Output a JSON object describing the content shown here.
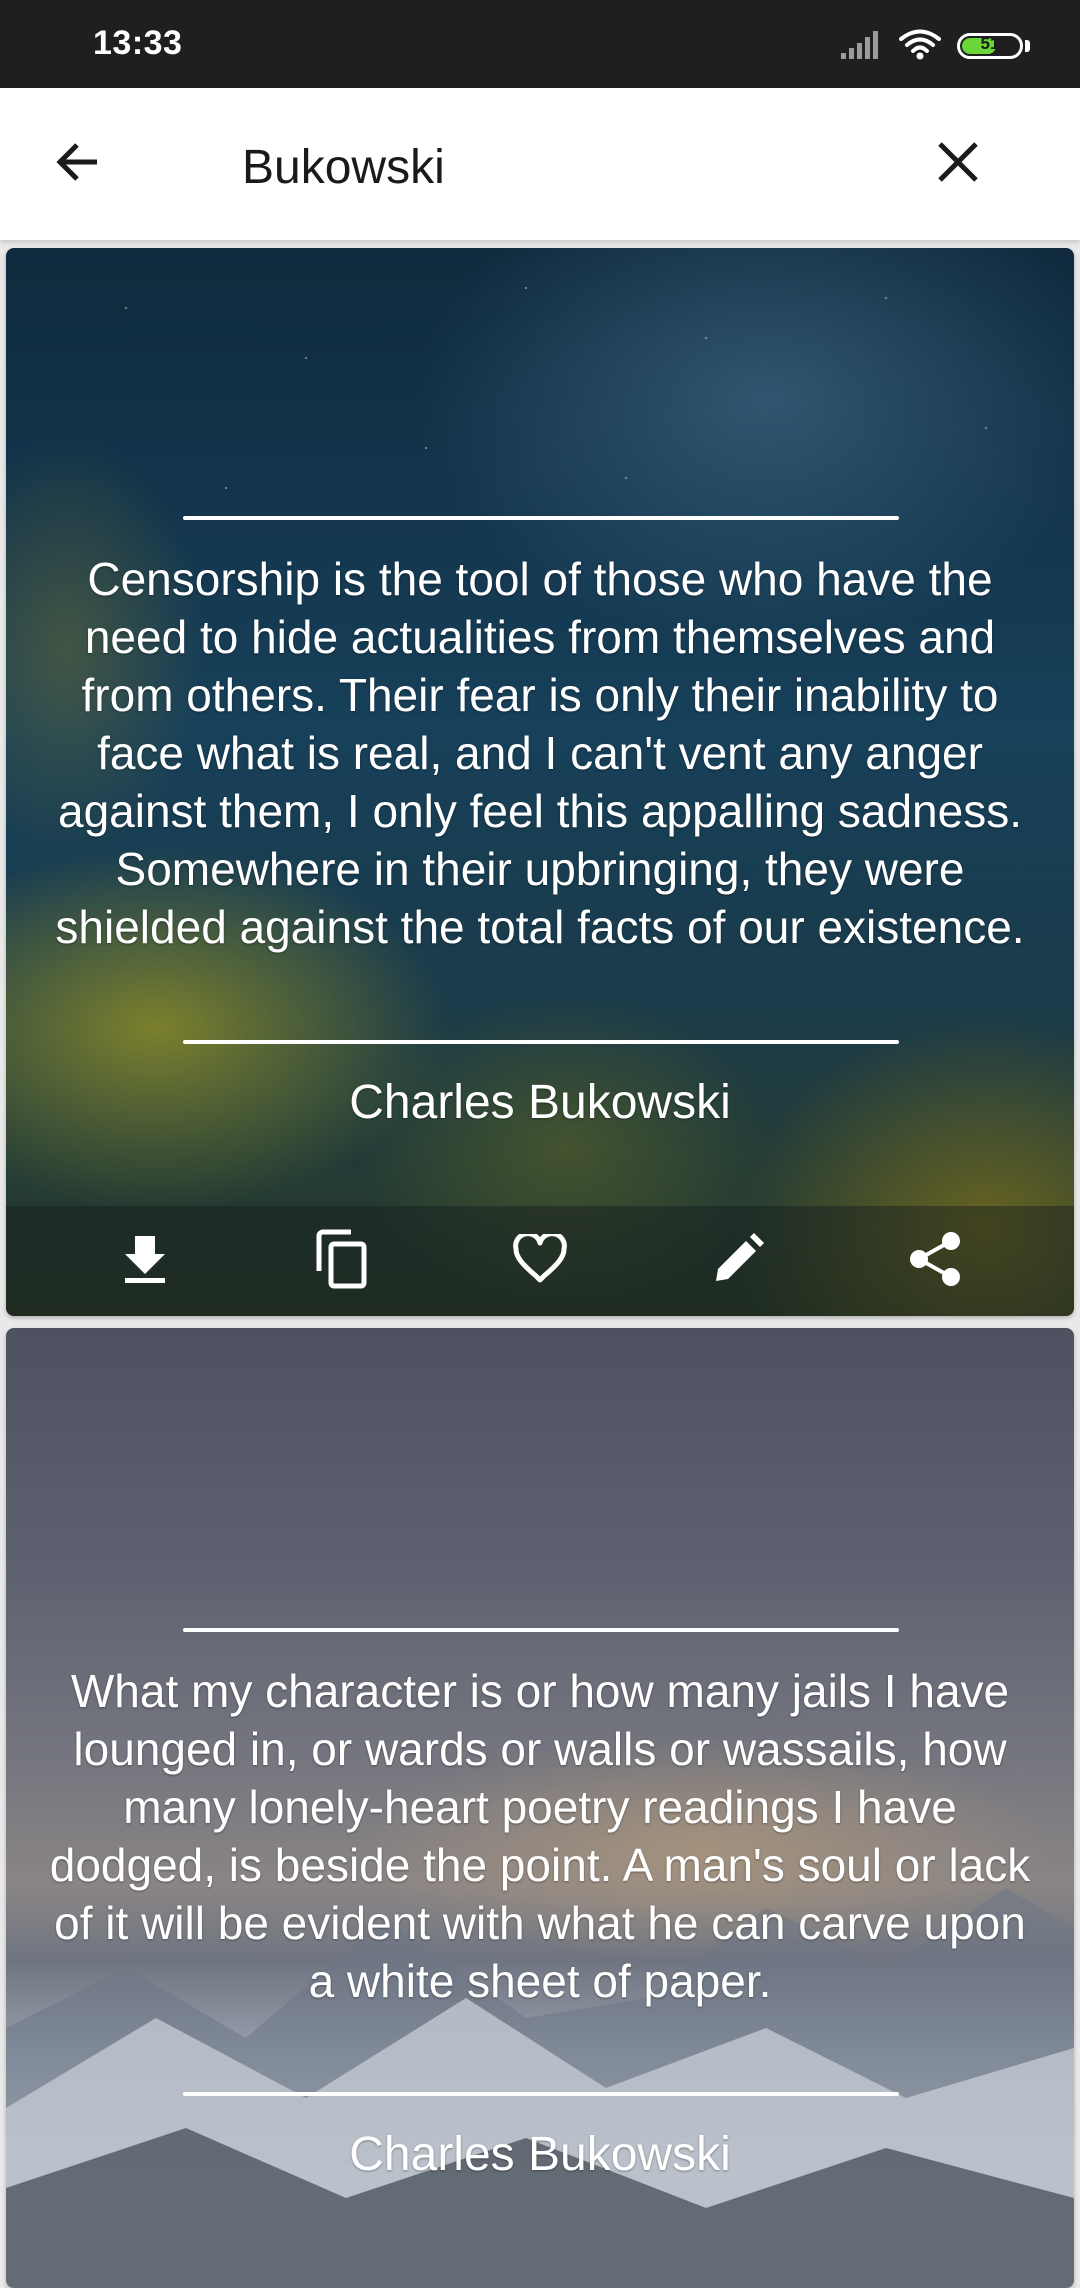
{
  "status_bar": {
    "time": "13:33",
    "battery_level": "51",
    "icons": [
      "signal-icon",
      "wifi-icon",
      "battery-icon"
    ]
  },
  "app_bar": {
    "back_icon": "arrow-left-icon",
    "search_value": "Bukowski",
    "clear_icon": "close-icon"
  },
  "quotes": [
    {
      "text": "Censorship is the tool of those who have the need to hide actualities from themselves and from others. Their fear is only their inability to face what is real, and I can't vent any anger against them, I only feel this appalling sadness. Somewhere in their upbringing, they were shielded against the total facts of our existence.",
      "author": "Charles Bukowski",
      "actions": [
        "download-icon",
        "copy-icon",
        "heart-icon",
        "edit-icon",
        "share-icon"
      ]
    },
    {
      "text": "What my character is or how many jails I have lounged in, or wards or walls or wassails, how many lonely-heart poetry readings I have dodged, is beside the point. A man's soul or lack of it will be evident with what he can carve upon a white sheet of paper.",
      "author": "Charles Bukowski"
    }
  ],
  "colors": {
    "status_bar_bg": "#1f1f1f",
    "app_bar_bg": "#ffffff",
    "battery_fill": "#6bd637",
    "quote_text": "#ffffff"
  }
}
